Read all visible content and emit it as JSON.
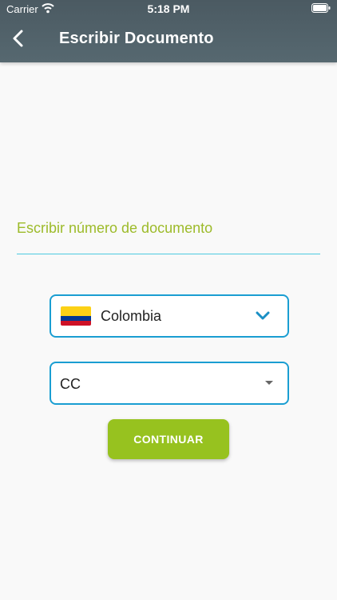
{
  "status_bar": {
    "carrier": "Carrier",
    "time": "5:18 PM"
  },
  "header": {
    "title": "Escribir Documento",
    "back_icon": "chevron-left-icon"
  },
  "document_field": {
    "placeholder": "Escribir número de documento",
    "value": ""
  },
  "country_select": {
    "selected": "Colombia",
    "flag_icon": "colombia-flag-icon",
    "dropdown_icon": "chevron-down-icon"
  },
  "doc_type_select": {
    "selected": "CC",
    "dropdown_icon": "caret-down-icon"
  },
  "continue_button": {
    "label": "CONTINUAR"
  },
  "colors": {
    "header": "#4f5f67",
    "accent_green": "#97c21f",
    "accent_blue": "#1a9ed2",
    "field_underline": "#4ccbe0",
    "placeholder": "#9dbb2a"
  }
}
